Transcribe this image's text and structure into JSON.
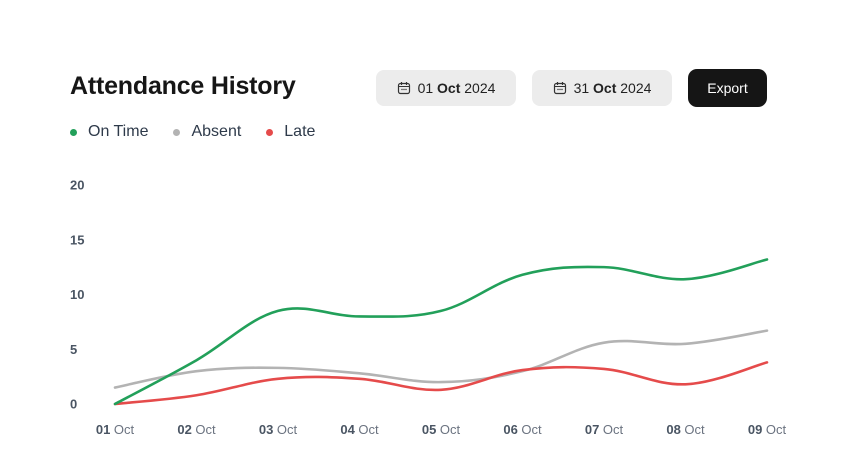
{
  "header": {
    "title": "Attendance History",
    "date_start": {
      "day": "01",
      "month": "Oct",
      "year": "2024",
      "icon": "calendar-icon"
    },
    "date_end": {
      "day": "31",
      "month": "Oct",
      "year": "2024",
      "icon": "calendar-icon"
    },
    "export_label": "Export"
  },
  "chart_data": {
    "type": "line",
    "title": "Attendance History",
    "x": [
      "01 Oct",
      "02 Oct",
      "03 Oct",
      "04 Oct",
      "05 Oct",
      "06 Oct",
      "07 Oct",
      "08 Oct",
      "09 Oct"
    ],
    "x_labels": [
      {
        "day": "01",
        "mon": "Oct"
      },
      {
        "day": "02",
        "mon": "Oct"
      },
      {
        "day": "03",
        "mon": "Oct"
      },
      {
        "day": "04",
        "mon": "Oct"
      },
      {
        "day": "05",
        "mon": "Oct"
      },
      {
        "day": "06",
        "mon": "Oct"
      },
      {
        "day": "07",
        "mon": "Oct"
      },
      {
        "day": "08",
        "mon": "Oct"
      },
      {
        "day": "09",
        "mon": "Oct"
      }
    ],
    "ylim": [
      0,
      20
    ],
    "yticks": [
      0,
      5,
      10,
      15,
      20
    ],
    "grid": false,
    "legend_position": "top-left",
    "smooth": true,
    "series": [
      {
        "name": "On Time",
        "color": "#22a05a",
        "values": [
          0,
          4,
          8.5,
          8,
          8.5,
          11.8,
          12.5,
          11.4,
          13.2
        ]
      },
      {
        "name": "Absent",
        "color": "#b3b3b3",
        "values": [
          1.5,
          3,
          3.3,
          2.8,
          2,
          3,
          5.6,
          5.5,
          6.7
        ]
      },
      {
        "name": "Late",
        "color": "#e54b4b",
        "values": [
          0,
          0.8,
          2.3,
          2.3,
          1.3,
          3.1,
          3.2,
          1.8,
          3.8
        ]
      }
    ]
  }
}
